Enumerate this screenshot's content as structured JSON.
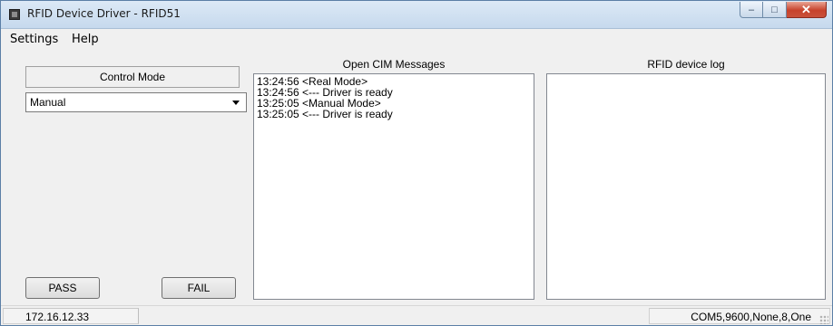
{
  "window": {
    "title": "RFID Device Driver - RFID51",
    "icon": "app-icon"
  },
  "menu": {
    "items": [
      {
        "label": "Settings"
      },
      {
        "label": "Help"
      }
    ]
  },
  "control": {
    "mode_label": "Control Mode",
    "mode_value": "Manual",
    "mode_options_visible": [
      "Manual"
    ],
    "pass_label": "PASS",
    "fail_label": "FAIL"
  },
  "cim": {
    "title": "Open CIM Messages",
    "lines": [
      "13:24:56 <Real Mode>",
      "13:24:56 <--- Driver is ready",
      "13:25:05 <Manual Mode>",
      "13:25:05 <--- Driver is ready"
    ]
  },
  "device_log": {
    "title": "RFID device log",
    "lines": []
  },
  "status": {
    "ip": "172.16.12.33",
    "port_settings": "COM5,9600,None,8,One"
  },
  "colors": {
    "titlebar": "#c6d9ed",
    "close_button": "#c7422c",
    "window_bg": "#f0f0f0"
  }
}
